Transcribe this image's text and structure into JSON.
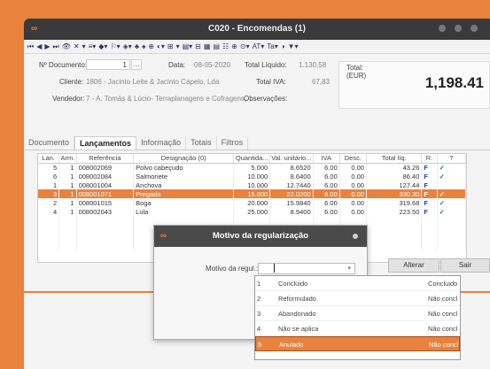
{
  "window": {
    "title": "C020 - Encomendas (1)",
    "logo": "∞"
  },
  "toolbar": [
    "⏮",
    "◀",
    "▶",
    "⏭",
    "👁",
    "✕",
    "▾",
    "≡▾",
    "◆▾",
    "⚐▾",
    "◈▾",
    "♣",
    "♠",
    "⊕",
    "◐▾",
    "⊞",
    "▾",
    "▤▾",
    "⊟",
    "▦",
    "▤",
    "☷",
    "⊕",
    "⊙▾",
    "AT▾",
    "Ta▾",
    "◑",
    "▼▾"
  ],
  "header": {
    "doc_label": "Nº Documento:",
    "doc_value": "1",
    "date_label": "Data:",
    "date_value": "08-05-2020",
    "liquido_label": "Total Líquido:",
    "liquido_value": "1.130,58",
    "total_label": "Total:",
    "total_currency": "(EUR)",
    "cliente_label": "Cliente:",
    "cliente_value": "1806 - Jacinto Leite & Jacinto Capelo, Lda",
    "iva_label": "Total IVA:",
    "iva_value": "67,83",
    "vendedor_label": "Vendedor:",
    "vendedor_value": "7 - A. Tomás & Lúcio- Terraplanagens e Cofragens,",
    "obs_label": "Observações:",
    "big_total": "1,198.41"
  },
  "tabs": [
    "Documento",
    "Lançamentos",
    "Informação",
    "Totais",
    "Filtros"
  ],
  "grid": {
    "columns": [
      "Lan.",
      "Arm.",
      "Referência",
      "Designação (0)",
      "Quantida...",
      "Val. unitário...",
      "IVA",
      "Desc.",
      "Total líq.",
      "R.",
      "?"
    ],
    "rows": [
      {
        "lan": "5",
        "arm": "1",
        "ref": "008002069",
        "des": "Polvo cabeçudo",
        "qtd": "5.000",
        "val": "8.6520",
        "iva": "6.00",
        "desc": "0.00",
        "tot": "43.26",
        "f": "F",
        "ck": "✓"
      },
      {
        "lan": "6",
        "arm": "1",
        "ref": "008002084",
        "des": "Salmonete",
        "qtd": "10.000",
        "val": "8.6400",
        "iva": "6.00",
        "desc": "0.00",
        "tot": "86.40",
        "f": "F",
        "ck": "✓"
      },
      {
        "lan": "1",
        "arm": "1",
        "ref": "008001004",
        "des": "Anchova",
        "qtd": "10.000",
        "val": "12.7440",
        "iva": "6.00",
        "desc": "0.00",
        "tot": "127.44",
        "f": "F",
        "ck": ""
      },
      {
        "lan": "3",
        "arm": "1",
        "ref": "008001071",
        "des": "Pregado",
        "qtd": "15.000",
        "val": "22.0200",
        "iva": "6.00",
        "desc": "0.00",
        "tot": "330.30",
        "f": "F",
        "ck": "✓"
      },
      {
        "lan": "2",
        "arm": "1",
        "ref": "008001015",
        "des": "Boga",
        "qtd": "20.000",
        "val": "15.9840",
        "iva": "6.00",
        "desc": "0.00",
        "tot": "319.68",
        "f": "F",
        "ck": "✓"
      },
      {
        "lan": "4",
        "arm": "1",
        "ref": "008002043",
        "des": "Lula",
        "qtd": "25.000",
        "val": "8.9400",
        "iva": "6.00",
        "desc": "0.00",
        "tot": "223.50",
        "f": "F",
        "ck": "✓"
      }
    ],
    "selected_index": 3
  },
  "buttons": {
    "alterar": "Alterar",
    "sair": "Sair"
  },
  "modal": {
    "title": "Motivo da regularização",
    "label": "Motivo da regul.:",
    "select_value": ""
  },
  "dropdown": [
    {
      "n": "1",
      "a": "Concluido",
      "b": "Concluido"
    },
    {
      "n": "2",
      "a": "Reformulado",
      "b": "Não concl"
    },
    {
      "n": "3",
      "a": "Abandonado",
      "b": "Não concl"
    },
    {
      "n": "4",
      "a": "Não se aplica",
      "b": "Não concl"
    },
    {
      "n": "5",
      "a": "Anulado",
      "b": "Não concl"
    }
  ],
  "dropdown_highlight": 4,
  "colors": {
    "accent": "#e8823d",
    "title_bg": "#3a3a3a",
    "check": "#1a8a2a",
    "flag": "#1a3fb5"
  }
}
